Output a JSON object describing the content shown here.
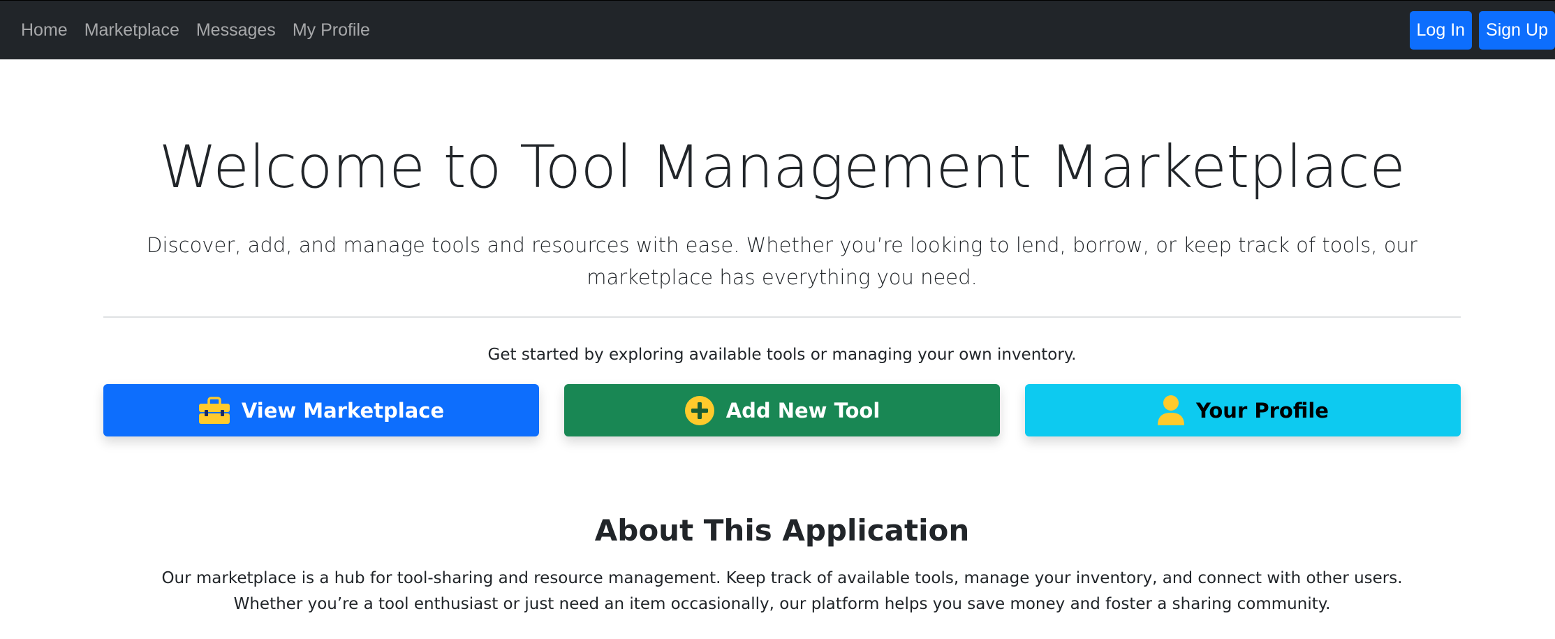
{
  "nav": {
    "links": [
      "Home",
      "Marketplace",
      "Messages",
      "My Profile"
    ],
    "login_label": "Log In",
    "signup_label": "Sign Up"
  },
  "hero": {
    "title": "Welcome to Tool Management Marketplace",
    "lead": "Discover, add, and manage tools and resources with ease. Whether you’re looking to lend, borrow, or keep track of tools, our marketplace has everything you need.",
    "subtitle": "Get started by exploring available tools or managing your own inventory."
  },
  "actions": {
    "view_marketplace": {
      "label": "View Marketplace",
      "icon": "toolbox-icon"
    },
    "add_tool": {
      "label": "Add New Tool",
      "icon": "plus-circle-icon"
    },
    "profile": {
      "label": "Your Profile",
      "icon": "person-icon"
    }
  },
  "about": {
    "title": "About This Application",
    "text": "Our marketplace is a hub for tool-sharing and resource management. Keep track of available tools, manage your inventory, and connect with other users. Whether you’re a tool enthusiast or just need an item occasionally, our platform helps you save money and foster a sharing community."
  },
  "colors": {
    "navbar": "#212529",
    "primary": "#0d6efd",
    "success": "#198754",
    "info": "#0dcaf0",
    "icon_yellow": "#ffca2c"
  }
}
